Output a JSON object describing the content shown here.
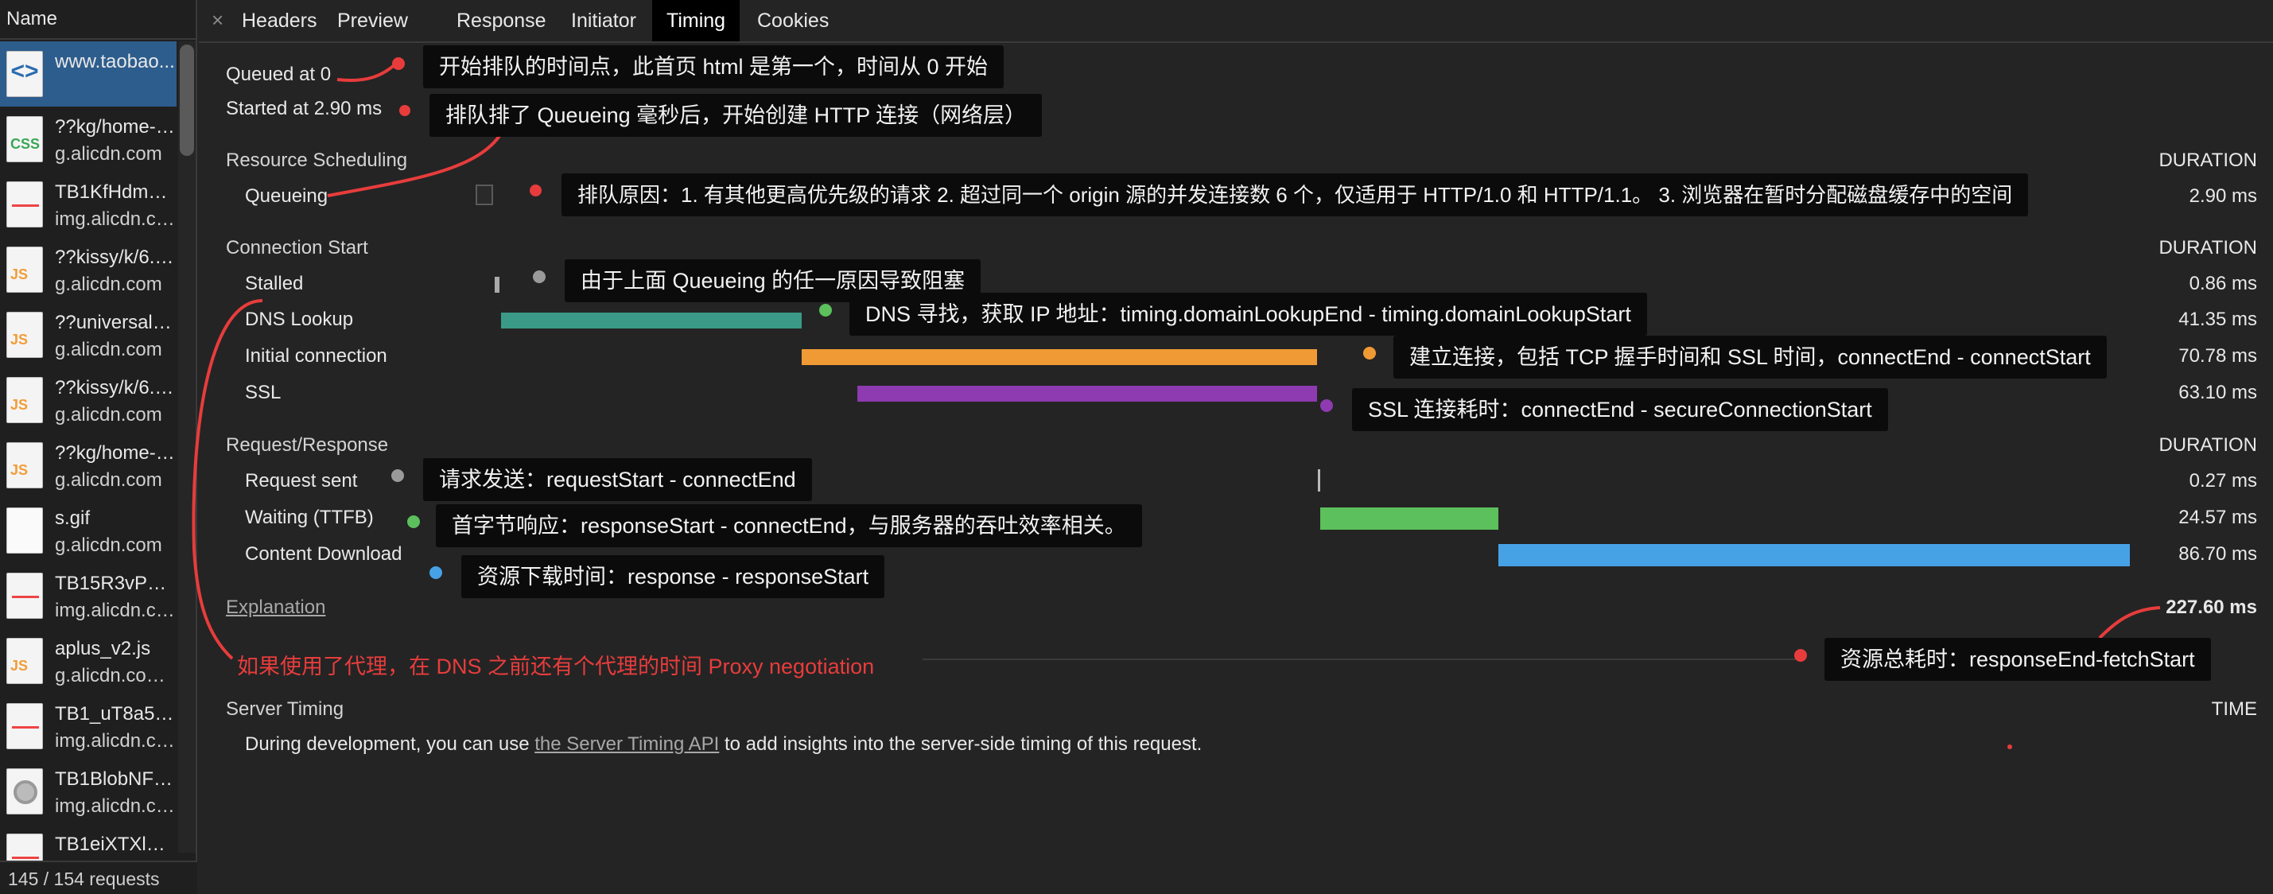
{
  "sidebar": {
    "header": "Name",
    "footer": "145 / 154 requests",
    "requests": [
      {
        "name": "www.taobao...",
        "host": "",
        "icon": "html-document-icon",
        "badge": "<>",
        "badge_color": "#2b6cb0",
        "selected": true
      },
      {
        "name": "??kg/home-2...",
        "host": "g.alicdn.com",
        "icon": "css-file-icon",
        "badge": "CSS",
        "badge_color": "#3aa757"
      },
      {
        "name": "TB1KfHdmR...",
        "host": "img.alicdn.co...",
        "icon": "image-file-icon",
        "badge": "",
        "badge_color": "#e44"
      },
      {
        "name": "??kissy/k/6.2...",
        "host": "g.alicdn.com",
        "icon": "js-file-icon",
        "badge": "JS",
        "badge_color": "#f29d38"
      },
      {
        "name": "??universal/p...",
        "host": "g.alicdn.com",
        "icon": "js-file-icon",
        "badge": "JS",
        "badge_color": "#f29d38"
      },
      {
        "name": "??kissy/k/6.2...",
        "host": "g.alicdn.com",
        "icon": "js-file-icon",
        "badge": "JS",
        "badge_color": "#f29d38"
      },
      {
        "name": "??kg/home-2...",
        "host": "g.alicdn.com",
        "icon": "js-file-icon",
        "badge": "JS",
        "badge_color": "#f29d38"
      },
      {
        "name": "s.gif",
        "host": "g.alicdn.com",
        "icon": "gif-file-icon",
        "badge": "",
        "badge_color": "#fafafa"
      },
      {
        "name": "TB15R3vP7Y...",
        "host": "img.alicdn.co...",
        "icon": "image-file-icon",
        "badge": "",
        "badge_color": "#e44"
      },
      {
        "name": "aplus_v2.js",
        "host": "g.alicdn.com...",
        "icon": "js-file-icon",
        "badge": "JS",
        "badge_color": "#f29d38"
      },
      {
        "name": "TB1_uT8a5E...",
        "host": "img.alicdn.co...",
        "icon": "image-file-icon",
        "badge": "",
        "badge_color": "#e44"
      },
      {
        "name": "TB1BlobNFX...",
        "host": "img.alicdn.co...",
        "icon": "image-file-icon",
        "badge": "",
        "badge_color": "#999"
      },
      {
        "name": "TB1eiXTXlTH...",
        "host": "",
        "icon": "image-file-icon",
        "badge": "",
        "badge_color": "#e44"
      }
    ]
  },
  "tabs": {
    "close": "×",
    "items": [
      "Headers",
      "Preview",
      "Response",
      "Initiator",
      "Timing",
      "Cookies"
    ],
    "active": "Timing"
  },
  "timing": {
    "queued_at": "Queued at 0",
    "started_at": "Started at 2.90 ms",
    "duration_label": "DURATION",
    "sections": {
      "resource_scheduling": "Resource Scheduling",
      "connection_start": "Connection Start",
      "request_response": "Request/Response"
    },
    "rows": {
      "queueing": {
        "label": "Queueing",
        "duration": "2.90 ms"
      },
      "stalled": {
        "label": "Stalled",
        "duration": "0.86 ms"
      },
      "dns": {
        "label": "DNS Lookup",
        "duration": "41.35 ms"
      },
      "initial": {
        "label": "Initial connection",
        "duration": "70.78 ms"
      },
      "ssl": {
        "label": "SSL",
        "duration": "63.10 ms"
      },
      "sent": {
        "label": "Request sent",
        "duration": "0.27 ms"
      },
      "waiting": {
        "label": "Waiting (TTFB)",
        "duration": "24.57 ms"
      },
      "download": {
        "label": "Content Download",
        "duration": "86.70 ms"
      }
    },
    "explanation": "Explanation",
    "total": "227.60 ms",
    "server_timing": {
      "title": "Server Timing",
      "time_label": "TIME",
      "text_before": "During development, you can use ",
      "link": "the Server Timing API",
      "text_after": " to add insights into the server-side timing of this request."
    }
  },
  "annotations": {
    "queued": "开始排队的时间点，此首页 html 是第一个，时间从 0 开始",
    "started": "排队排了 Queueing 毫秒后，开始创建 HTTP 连接（网络层）",
    "queueing": "排队原因：1. 有其他更高优先级的请求 2. 超过同一个 origin 源的并发连接数 6 个，仅适用于 HTTP/1.0 和 HTTP/1.1。 3. 浏览器在暂时分配磁盘缓存中的空间",
    "stalled": "由于上面 Queueing 的任一原因导致阻塞",
    "dns": "DNS 寻找，获取 IP 地址：timing.domainLookupEnd - timing.domainLookupStart",
    "initial": "建立连接，包括 TCP 握手时间和 SSL 时间，connectEnd - connectStart",
    "ssl": "SSL 连接耗时：connectEnd - secureConnectionStart",
    "sent": "请求发送：requestStart - connectEnd",
    "waiting": "首字节响应：responseStart - connectEnd，与服务器的吞吐效率相关。",
    "download": "资源下载时间：response - responseStart",
    "proxy": "如果使用了代理，在 DNS 之前还有个代理的时间 Proxy negotiation",
    "total": "资源总耗时：responseEnd-fetchStart"
  },
  "colors": {
    "dns": "#3a9a87",
    "initial": "#f09a36",
    "ssl": "#8e3ab0",
    "waiting": "#5cc05c",
    "download": "#47a1e5",
    "annotation_red": "#e83c3c",
    "selected_row": "#2d5d8d"
  }
}
